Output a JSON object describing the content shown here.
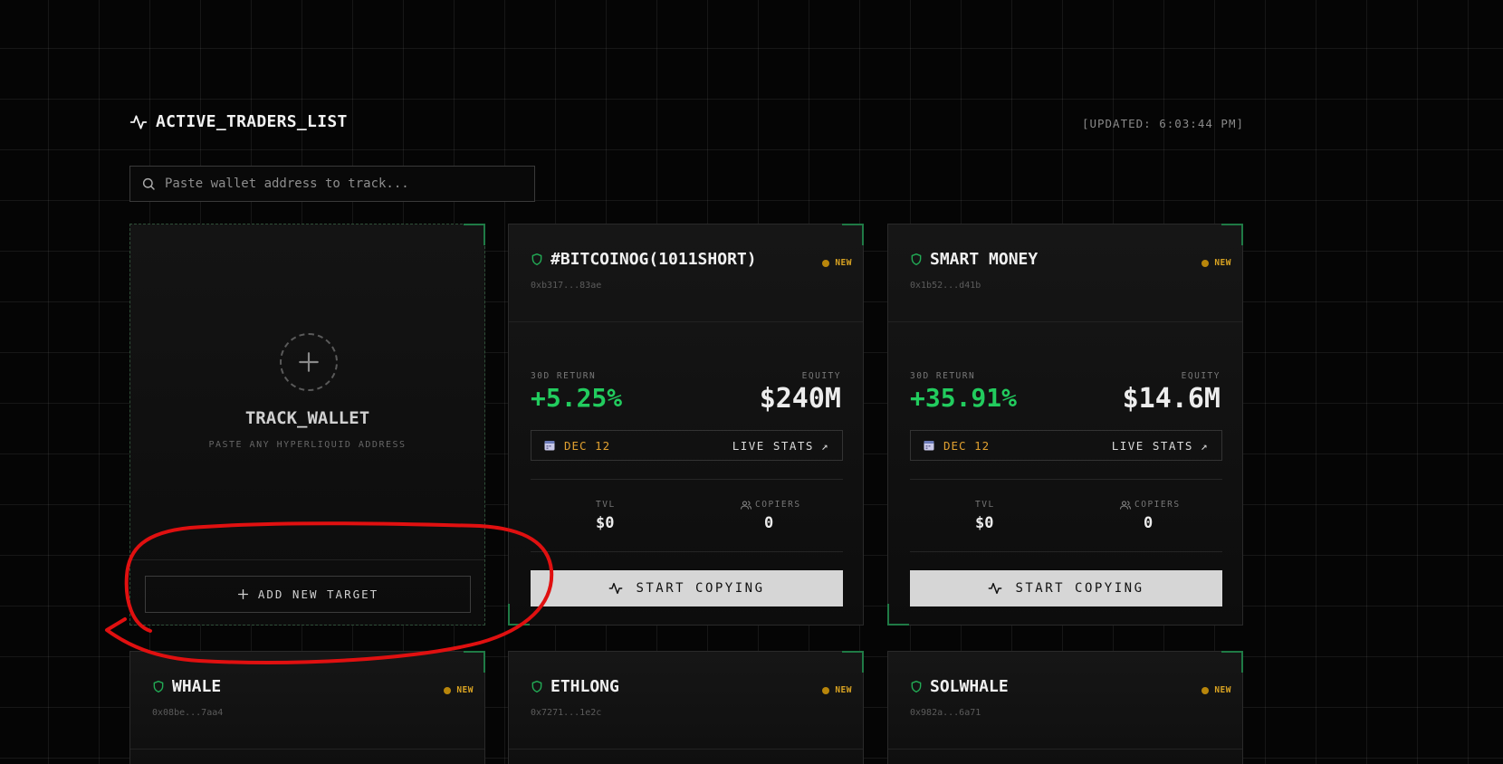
{
  "header": {
    "title": "ACTIVE_TRADERS_LIST",
    "updated": "[UPDATED: 6:03:44 PM]"
  },
  "search": {
    "placeholder": "Paste wallet address to track..."
  },
  "track_card": {
    "title": "TRACK_WALLET",
    "subtitle": "PASTE ANY HYPERLIQUID ADDRESS",
    "button_label": "ADD NEW TARGET"
  },
  "labels": {
    "return": "30D RETURN",
    "equity": "EQUITY",
    "tvl": "TVL",
    "copiers": "COPIERS",
    "live_stats": "LIVE STATS",
    "start_copying": "START COPYING",
    "new_badge": "NEW"
  },
  "traders": [
    {
      "name": "#BITCOINOG(1011SHORT)",
      "address": "0xb317...83ae",
      "return": "+5.25%",
      "equity": "$240M",
      "date": "DEC 12",
      "tvl": "$0",
      "copiers": "0"
    },
    {
      "name": "SMART MONEY",
      "address": "0x1b52...d41b",
      "return": "+35.91%",
      "equity": "$14.6M",
      "date": "DEC 12",
      "tvl": "$0",
      "copiers": "0"
    },
    {
      "name": "WHALE",
      "address": "0x08be...7aa4"
    },
    {
      "name": "ETHLONG",
      "address": "0x7271...1e2c"
    },
    {
      "name": "SOLWHALE",
      "address": "0x982a...6a71"
    }
  ],
  "colors": {
    "accent_green": "#22cc5e",
    "badge_gold": "#d9a322",
    "annotation_red": "#e01010"
  }
}
